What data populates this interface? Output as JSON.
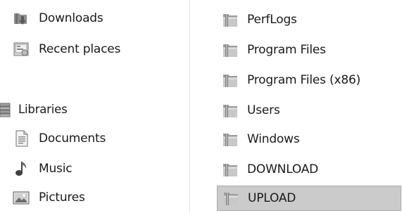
{
  "navigation": {
    "favorites": [
      {
        "label": "Downloads",
        "icon": "downloads-icon"
      },
      {
        "label": "Recent places",
        "icon": "recent-places-icon"
      }
    ],
    "libraries": {
      "label": "Libraries",
      "icon": "libraries-icon",
      "items": [
        {
          "label": "Documents",
          "icon": "documents-icon"
        },
        {
          "label": "Music",
          "icon": "music-icon"
        },
        {
          "label": "Pictures",
          "icon": "pictures-icon"
        }
      ]
    }
  },
  "files": [
    {
      "name": "PerfLogs",
      "icon": "folder-icon"
    },
    {
      "name": "Program Files",
      "icon": "folder-icon"
    },
    {
      "name": "Program Files (x86)",
      "icon": "folder-icon"
    },
    {
      "name": "Users",
      "icon": "folder-icon"
    },
    {
      "name": "Windows",
      "icon": "folder-icon"
    },
    {
      "name": "DOWNLOAD",
      "icon": "folder-icon"
    },
    {
      "name": "UPLOAD",
      "icon": "folder-icon",
      "selected": true
    }
  ],
  "colors": {
    "selection_background": "#cbcbcb",
    "selection_border": "#a9a9a9",
    "text": "#1a1a1a"
  }
}
